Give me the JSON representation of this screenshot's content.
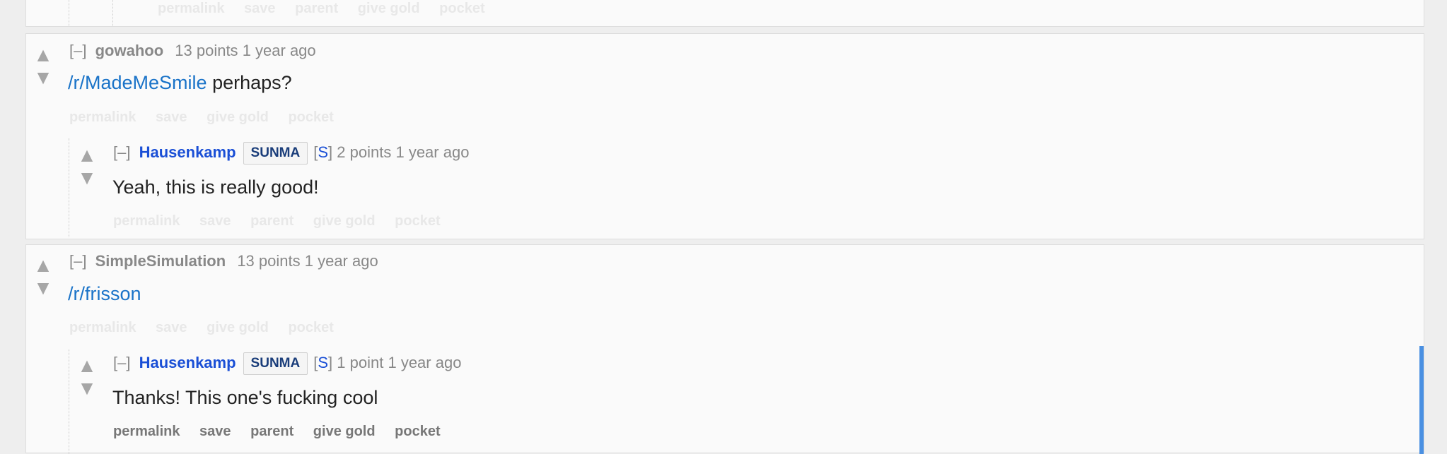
{
  "top_fragment": {
    "buttons": [
      "permalink",
      "save",
      "parent",
      "give gold",
      "pocket"
    ]
  },
  "comments": [
    {
      "expand": "[–]",
      "author": "gowahoo",
      "score": "13 points",
      "time": "1 year ago",
      "body_link": "/r/MadeMeSmile",
      "body_text": " perhaps?",
      "buttons": [
        "permalink",
        "save",
        "give gold",
        "pocket"
      ],
      "reply": {
        "expand": "[–]",
        "author": "Hausenkamp",
        "flair": "SUNMA",
        "op_open": "[",
        "op_marker": "S",
        "op_close": "]",
        "score": "2 points",
        "time": "1 year ago",
        "body_text": "Yeah, this is really good!",
        "buttons": [
          "permalink",
          "save",
          "parent",
          "give gold",
          "pocket"
        ]
      }
    },
    {
      "expand": "[–]",
      "author": "SimpleSimulation",
      "score": "13 points",
      "time": "1 year ago",
      "body_link": "/r/frisson",
      "body_text": "",
      "buttons": [
        "permalink",
        "save",
        "give gold",
        "pocket"
      ],
      "reply": {
        "expand": "[–]",
        "author": "Hausenkamp",
        "flair": "SUNMA",
        "op_open": "[",
        "op_marker": "S",
        "op_close": "]",
        "score": "1 point",
        "time": "1 year ago",
        "body_text": "Thanks! This one's fucking cool",
        "buttons": [
          "permalink",
          "save",
          "parent",
          "give gold",
          "pocket"
        ]
      }
    }
  ],
  "icons": {
    "upvote": "▲",
    "downvote": "▼"
  },
  "colors": {
    "link": "#1a73c8",
    "op_author": "#1a4fd6",
    "highlight": "#4a90e2"
  }
}
